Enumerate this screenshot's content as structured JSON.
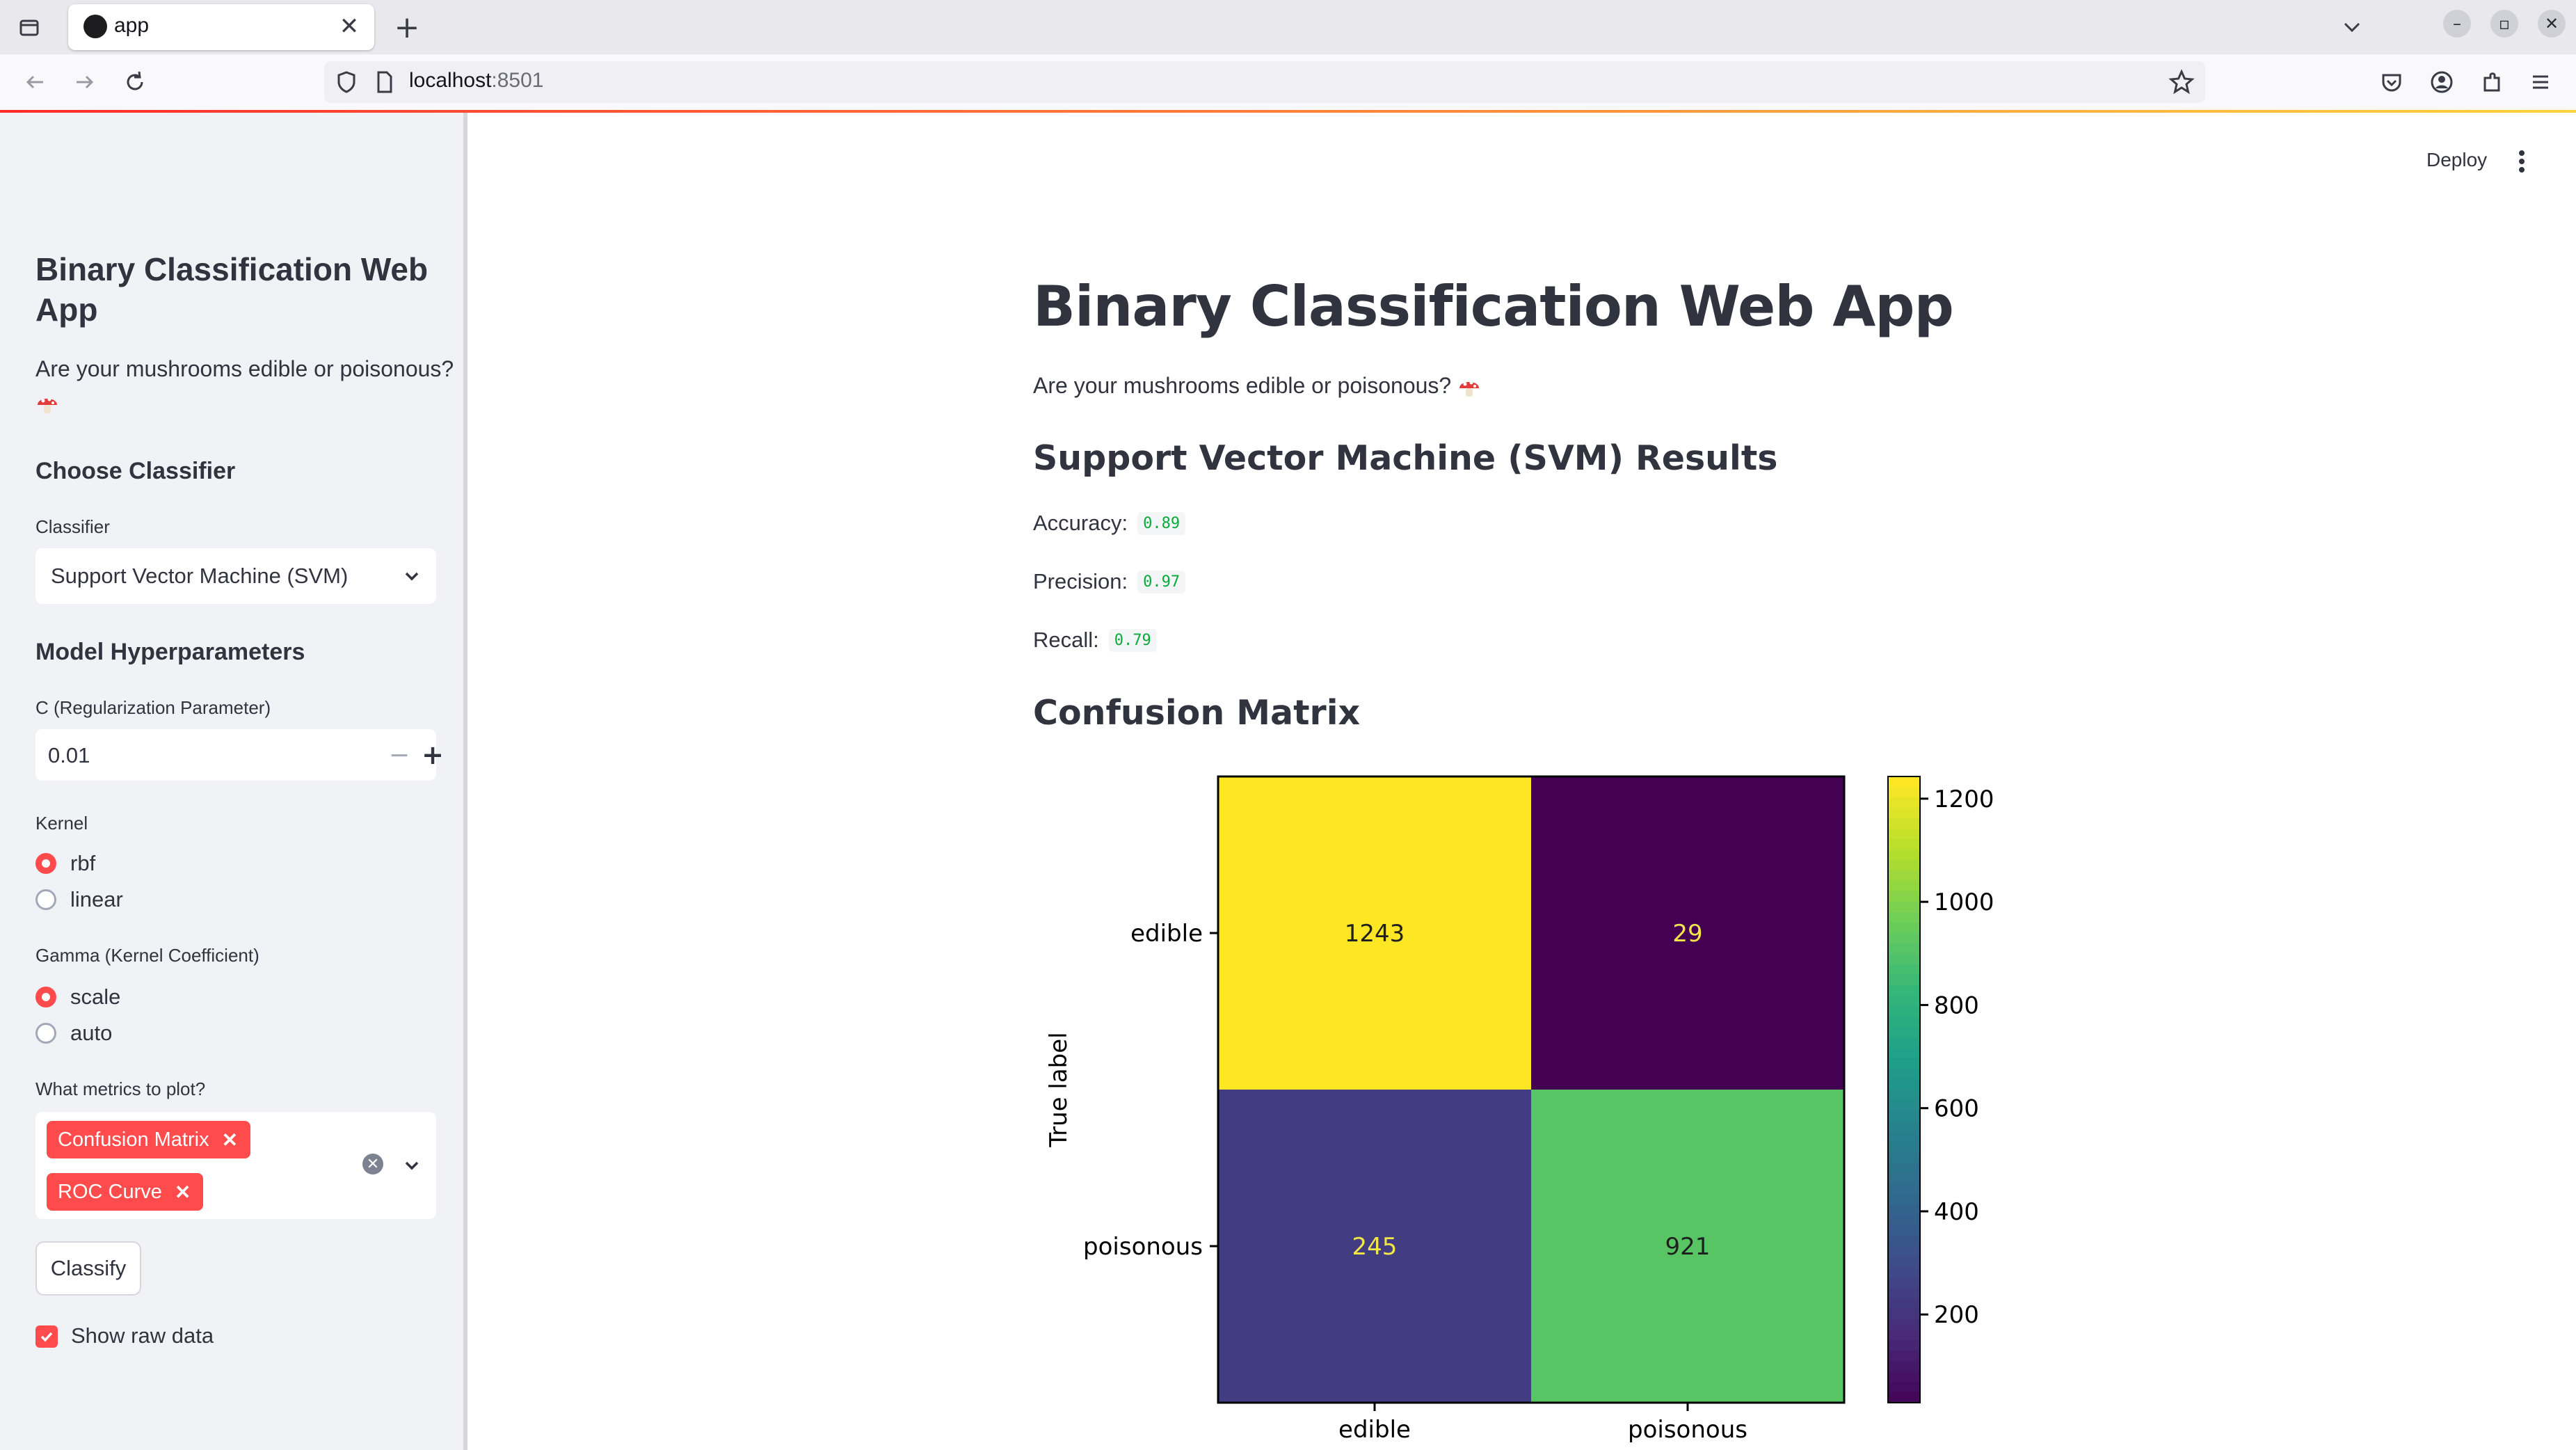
{
  "browser": {
    "tab_title": "app",
    "url_host": "localhost",
    "url_port": ":8501"
  },
  "toolbar": {
    "deploy_label": "Deploy"
  },
  "sidebar": {
    "title": "Binary Classification Web App",
    "subtitle": "Are your mushrooms edible or poisonous?",
    "choose_classifier_heading": "Choose Classifier",
    "classifier_label": "Classifier",
    "classifier_value": "Support Vector Machine (SVM)",
    "hyperparams_heading": "Model Hyperparameters",
    "c_label": "C (Regularization Parameter)",
    "c_value": "0.01",
    "kernel_label": "Kernel",
    "kernel_options": [
      "rbf",
      "linear"
    ],
    "kernel_selected": "rbf",
    "gamma_label": "Gamma (Kernel Coefficient)",
    "gamma_options": [
      "scale",
      "auto"
    ],
    "gamma_selected": "scale",
    "metrics_label": "What metrics to plot?",
    "metrics_selected": [
      "Confusion Matrix",
      "ROC Curve"
    ],
    "classify_button": "Classify",
    "show_raw_label": "Show raw data",
    "show_raw_checked": true
  },
  "main": {
    "title": "Binary Classification Web App",
    "subtitle": "Are your mushrooms edible or poisonous?",
    "results_heading": "Support Vector Machine (SVM) Results",
    "accuracy_label": "Accuracy:",
    "accuracy_value": "0.89",
    "precision_label": "Precision:",
    "precision_value": "0.97",
    "recall_label": "Recall:",
    "recall_value": "0.79",
    "confusion_heading": "Confusion Matrix"
  },
  "colors": {
    "accent": "#ff4b4b",
    "metric_value": "#09ab3b",
    "sidebar_bg": "#f0f2f6"
  },
  "chart_data": {
    "type": "heatmap",
    "row_labels": [
      "edible",
      "poisonous"
    ],
    "col_labels": [
      "edible",
      "poisonous"
    ],
    "values": [
      [
        1243,
        29
      ],
      [
        245,
        921
      ]
    ],
    "ylabel": "True label",
    "colormap": "viridis",
    "colorbar_ticks": [
      200,
      400,
      600,
      800,
      1000,
      1200
    ],
    "colorbar_range": [
      29,
      1243
    ]
  }
}
